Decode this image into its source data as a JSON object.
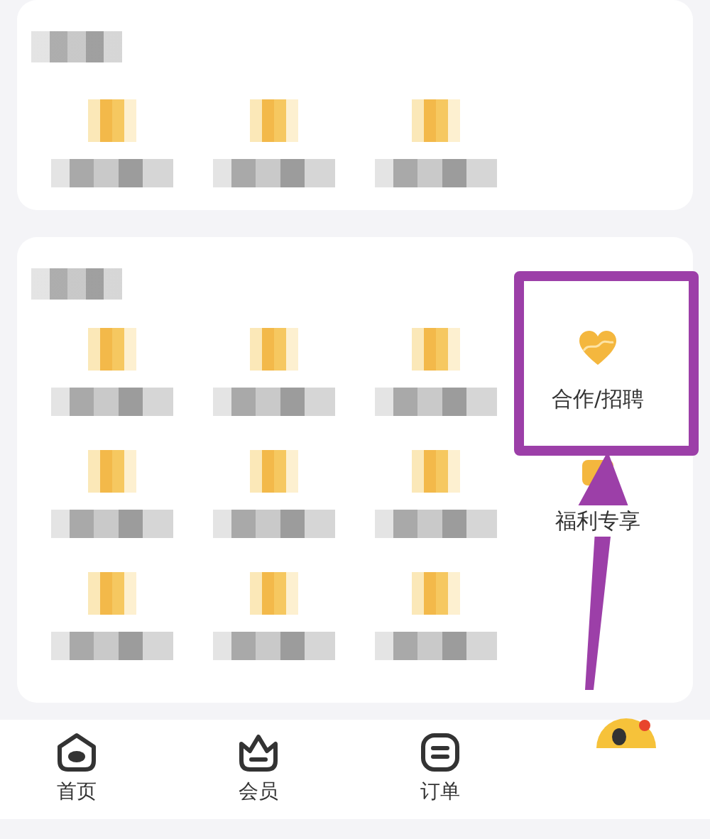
{
  "sections": [
    {
      "items": [
        {
          "kind": "pixelated"
        },
        {
          "kind": "pixelated"
        },
        {
          "kind": "pixelated"
        }
      ]
    },
    {
      "items": [
        {
          "kind": "pixelated"
        },
        {
          "kind": "pixelated"
        },
        {
          "kind": "pixelated"
        },
        {
          "kind": "service",
          "label": "合作/招聘",
          "highlighted": true
        },
        {
          "kind": "pixelated"
        },
        {
          "kind": "pixelated"
        },
        {
          "kind": "pixelated"
        },
        {
          "kind": "service",
          "label": "福利专享",
          "highlighted": false
        },
        {
          "kind": "pixelated"
        },
        {
          "kind": "pixelated"
        },
        {
          "kind": "pixelated"
        }
      ]
    }
  ],
  "tabs": [
    {
      "label": "首页",
      "selected": false
    },
    {
      "label": "会员",
      "selected": false
    },
    {
      "label": "订单",
      "selected": false
    }
  ]
}
